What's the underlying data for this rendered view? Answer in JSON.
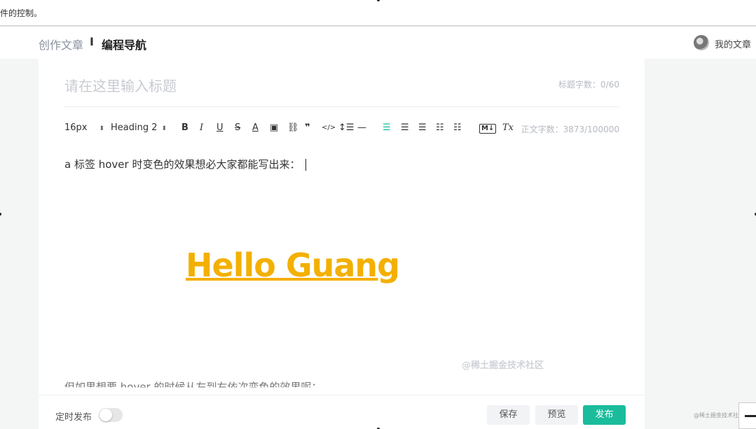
{
  "top_strip": {
    "text": "件的控制。"
  },
  "header": {
    "crumb": "创作文章",
    "separator": "I",
    "current": "编程导航",
    "my_articles": "我的文章"
  },
  "editor": {
    "title_placeholder": "请在这里输入标题",
    "title_count": "标题字数：0/60",
    "toolbar": {
      "font_size": "16px",
      "heading": "Heading 2",
      "bold": "B",
      "italic": "I",
      "underline": "U",
      "strike": "S",
      "font_color": "A",
      "image": "▣",
      "link": "⛓",
      "quote": "❞",
      "code": "</>",
      "line_height": "↕☰",
      "hr": "—",
      "align_left": "☰",
      "align_center": "☰",
      "align_right": "☰",
      "ordered_list": "☷",
      "bullet_list": "☷",
      "markdown": "M↓",
      "clear_format": "Tx"
    },
    "word_count": "正文字数：3873/100000",
    "paragraph_1": "a 标签 hover 时变色的效果想必大家都能写出来：",
    "image_text": "Hello Guang",
    "image_watermark": "@稀土掘金技术社区",
    "paragraph_2": "但如果想要 hover 的时候从左到右依次变色的效果呢："
  },
  "footer": {
    "schedule_label": "定时发布",
    "save": "保存",
    "preview": "预览",
    "publish": "发布"
  },
  "corner_watermark": "@稀土掘金技术社区",
  "colors": {
    "accent": "#1abc9c",
    "hello": "#f3b000"
  }
}
